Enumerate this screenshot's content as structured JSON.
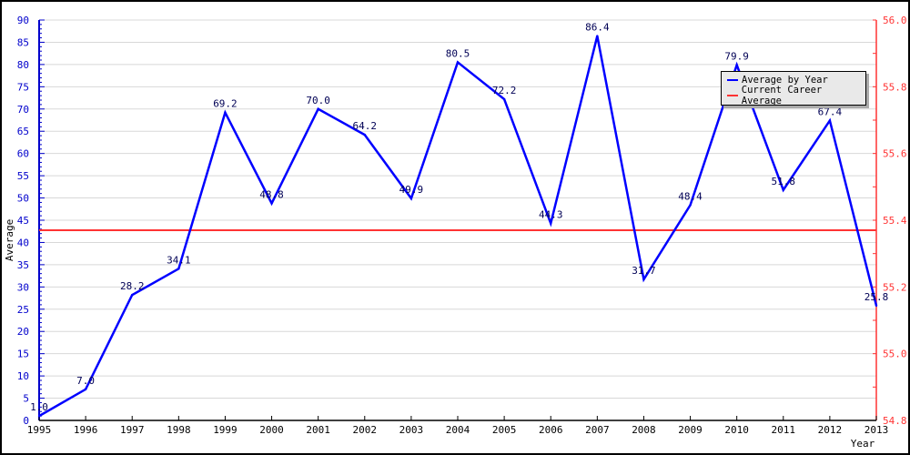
{
  "chart_data": {
    "type": "line",
    "title": "",
    "xlabel": "Year",
    "ylabel": "Average",
    "categories": [
      "1995",
      "1996",
      "1997",
      "1998",
      "1999",
      "2000",
      "2001",
      "2002",
      "2003",
      "2004",
      "2005",
      "2006",
      "2007",
      "2008",
      "2009",
      "2010",
      "2011",
      "2012",
      "2013"
    ],
    "series": [
      {
        "name": "Average by Year",
        "color": "#0000ff",
        "axis": "left",
        "values": [
          1.0,
          7.0,
          28.2,
          34.1,
          69.2,
          48.8,
          70.0,
          64.2,
          49.9,
          80.5,
          72.2,
          44.3,
          86.4,
          31.7,
          48.4,
          79.9,
          51.8,
          67.4,
          25.8
        ],
        "labels": [
          "1.0",
          "7.0",
          "28.2",
          "34.1",
          "69.2",
          "48.8",
          "70.0",
          "64.2",
          "49.9",
          "80.5",
          "72.2",
          "44.3",
          "86.4",
          "31.7",
          "48.4",
          "79.9",
          "51.8",
          "67.4",
          "25.8"
        ]
      },
      {
        "name": "Current Career Average",
        "color": "#ff3333",
        "axis": "right",
        "value": 55.37
      }
    ],
    "left_axis": {
      "min": 0,
      "max": 90,
      "step": 5,
      "ticks": [
        "0",
        "5",
        "10",
        "15",
        "20",
        "25",
        "30",
        "35",
        "40",
        "45",
        "50",
        "55",
        "60",
        "65",
        "70",
        "75",
        "80",
        "85",
        "90"
      ],
      "color": "#0000cc"
    },
    "right_axis": {
      "min": 54.8,
      "max": 56.0,
      "ticks": [
        "54.8",
        "55.0",
        "55.2",
        "55.4",
        "55.6",
        "55.8",
        "56.0"
      ],
      "color": "#ff3333"
    },
    "grid": true,
    "legend": {
      "position": "top-right",
      "entries": [
        "Average by Year",
        "Current Career Average"
      ]
    }
  }
}
